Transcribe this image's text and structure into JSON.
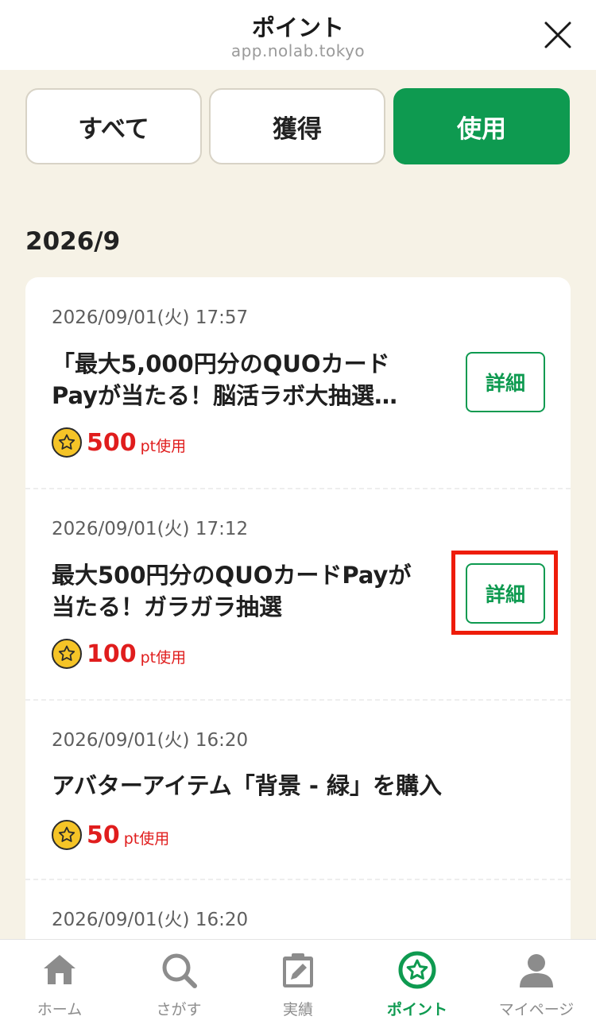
{
  "header": {
    "title": "ポイント",
    "domain": "app.nolab.tokyo",
    "close_icon": "close-icon"
  },
  "tabs": [
    {
      "label": "すべて",
      "active": false
    },
    {
      "label": "獲得",
      "active": false
    },
    {
      "label": "使用",
      "active": true
    }
  ],
  "month": "2026/9",
  "items": [
    {
      "date": "2026/09/01(火) 17:57",
      "title": "「最大5,000円分のQUOカード\nPayが当たる！脳活ラボ大抽選…",
      "points": "500",
      "unit": "pt使用",
      "detail_label": "詳細"
    },
    {
      "date": "2026/09/01(火) 17:12",
      "title": "最大500円分のQUOカードPayが\n当たる！ガラガラ抽選",
      "points": "100",
      "unit": "pt使用",
      "detail_label": "詳細"
    },
    {
      "date": "2026/09/01(火) 16:20",
      "title": "アバターアイテム「背景 - 緑」を購入",
      "points": "50",
      "unit": "pt使用"
    },
    {
      "date": "2026/09/01(火) 16:20"
    }
  ],
  "nav": [
    {
      "label": "ホーム",
      "icon": "home-icon",
      "active": false
    },
    {
      "label": "さがす",
      "icon": "search-icon",
      "active": false
    },
    {
      "label": "実績",
      "icon": "clipboard-edit-icon",
      "active": false
    },
    {
      "label": "ポイント",
      "icon": "star-coin-icon",
      "active": true
    },
    {
      "label": "マイページ",
      "icon": "user-icon",
      "active": false
    }
  ],
  "colors": {
    "accent_green": "#0e9a50",
    "points_red": "#e01d1d",
    "background": "#f6f2e6",
    "highlight_red": "#ee1c0a"
  }
}
